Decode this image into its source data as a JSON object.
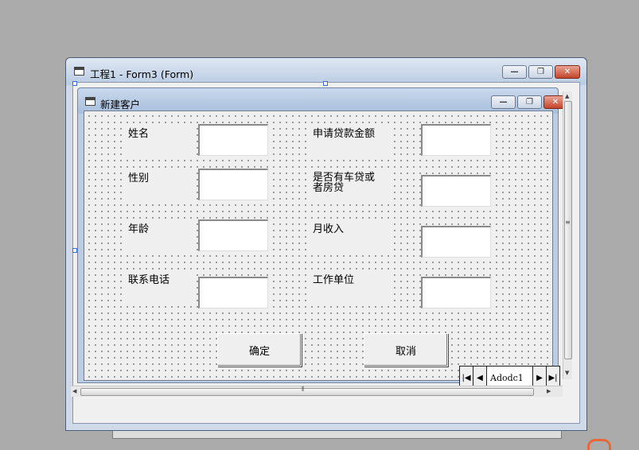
{
  "outer_window": {
    "title": "工程1 - Form3 (Form)",
    "minimize": "—",
    "restore": "❐",
    "close": "✕"
  },
  "form_window": {
    "title": "新建客户",
    "minimize": "—",
    "restore": "❐",
    "close": "✕"
  },
  "fields_left": [
    {
      "label": "姓名"
    },
    {
      "label": "性别"
    },
    {
      "label": "年龄"
    },
    {
      "label": "联系电话"
    }
  ],
  "fields_right": [
    {
      "label": "申请贷款金额"
    },
    {
      "label_line1": "是否有车贷或",
      "label_line2": "者房贷"
    },
    {
      "label": "月收入"
    },
    {
      "label": "工作单位"
    }
  ],
  "buttons": {
    "ok": "确定",
    "cancel": "取消"
  },
  "adodc": {
    "caption": "Adodc1",
    "first_icon": "first-record-icon",
    "prev_icon": "previous-record-icon",
    "next_icon": "next-record-icon",
    "last_icon": "last-record-icon"
  },
  "scrollbar": {
    "grip_v": "≡",
    "grip_h": "⦀"
  }
}
